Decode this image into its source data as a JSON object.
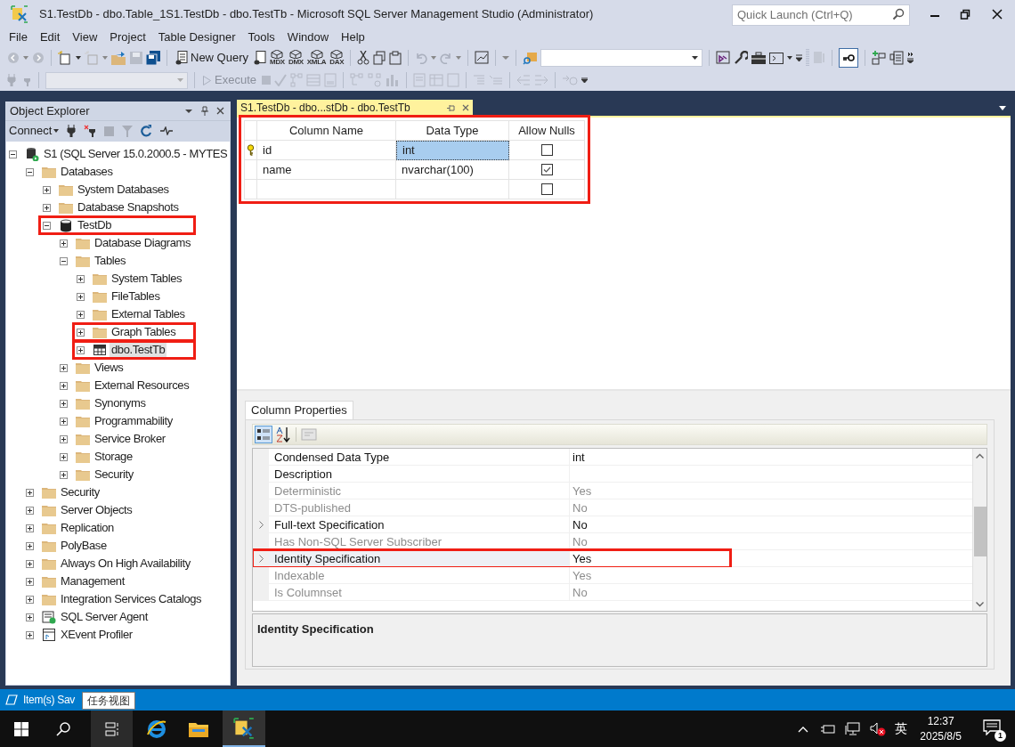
{
  "window": {
    "title": "S1.TestDb - dbo.Table_1S1.TestDb - dbo.TestTb - Microsoft SQL Server Management Studio (Administrator)"
  },
  "quick_launch": {
    "placeholder": "Quick Launch (Ctrl+Q)"
  },
  "menu": [
    "File",
    "Edit",
    "View",
    "Project",
    "Table Designer",
    "Tools",
    "Window",
    "Help"
  ],
  "toolbar": {
    "new_query": "New Query",
    "query_types": [
      "MDX",
      "DMX",
      "XMLA",
      "DAX"
    ],
    "execute": {
      "label": "Execute",
      "disabled": true
    }
  },
  "object_explorer": {
    "title": "Object Explorer",
    "connect": "Connect",
    "tree": [
      {
        "label": "S1 (SQL Server 15.0.2000.5 - MYTES",
        "kind": "server",
        "expanded": true,
        "selected": false,
        "highlighted": false,
        "children": [
          {
            "label": "Databases",
            "kind": "folder",
            "expanded": true,
            "selected": false,
            "highlighted": false,
            "children": [
              {
                "label": "System Databases",
                "kind": "folder",
                "expanded": false,
                "selected": false,
                "highlighted": false
              },
              {
                "label": "Database Snapshots",
                "kind": "folder",
                "expanded": false,
                "selected": false,
                "highlighted": false
              },
              {
                "label": "TestDb",
                "kind": "database",
                "expanded": true,
                "selected": false,
                "highlighted": true,
                "children": [
                  {
                    "label": "Database Diagrams",
                    "kind": "folder",
                    "expanded": false,
                    "selected": false,
                    "highlighted": false
                  },
                  {
                    "label": "Tables",
                    "kind": "folder",
                    "expanded": true,
                    "selected": false,
                    "highlighted": false,
                    "children": [
                      {
                        "label": "System Tables",
                        "kind": "folder",
                        "expanded": false,
                        "selected": false,
                        "highlighted": false
                      },
                      {
                        "label": "FileTables",
                        "kind": "folder",
                        "expanded": false,
                        "selected": false,
                        "highlighted": false
                      },
                      {
                        "label": "External Tables",
                        "kind": "folder",
                        "expanded": false,
                        "selected": false,
                        "highlighted": false
                      },
                      {
                        "label": "Graph Tables",
                        "kind": "folder",
                        "expanded": false,
                        "selected": false,
                        "highlighted": true
                      },
                      {
                        "label": "dbo.TestTb",
                        "kind": "table",
                        "expanded": false,
                        "selected": true,
                        "highlighted": true
                      }
                    ]
                  },
                  {
                    "label": "Views",
                    "kind": "folder",
                    "expanded": false,
                    "selected": false,
                    "highlighted": false
                  },
                  {
                    "label": "External Resources",
                    "kind": "folder",
                    "expanded": false,
                    "selected": false,
                    "highlighted": false
                  },
                  {
                    "label": "Synonyms",
                    "kind": "folder",
                    "expanded": false,
                    "selected": false,
                    "highlighted": false
                  },
                  {
                    "label": "Programmability",
                    "kind": "folder",
                    "expanded": false,
                    "selected": false,
                    "highlighted": false
                  },
                  {
                    "label": "Service Broker",
                    "kind": "folder",
                    "expanded": false,
                    "selected": false,
                    "highlighted": false
                  },
                  {
                    "label": "Storage",
                    "kind": "folder",
                    "expanded": false,
                    "selected": false,
                    "highlighted": false
                  },
                  {
                    "label": "Security",
                    "kind": "folder",
                    "expanded": false,
                    "selected": false,
                    "highlighted": false
                  }
                ]
              }
            ]
          },
          {
            "label": "Security",
            "kind": "folder",
            "expanded": false,
            "selected": false,
            "highlighted": false
          },
          {
            "label": "Server Objects",
            "kind": "folder",
            "expanded": false,
            "selected": false,
            "highlighted": false
          },
          {
            "label": "Replication",
            "kind": "folder",
            "expanded": false,
            "selected": false,
            "highlighted": false
          },
          {
            "label": "PolyBase",
            "kind": "folder",
            "expanded": false,
            "selected": false,
            "highlighted": false
          },
          {
            "label": "Always On High Availability",
            "kind": "folder",
            "expanded": false,
            "selected": false,
            "highlighted": false
          },
          {
            "label": "Management",
            "kind": "folder",
            "expanded": false,
            "selected": false,
            "highlighted": false
          },
          {
            "label": "Integration Services Catalogs",
            "kind": "folder",
            "expanded": false,
            "selected": false,
            "highlighted": false
          },
          {
            "label": "SQL Server Agent",
            "kind": "agent",
            "expanded": false,
            "selected": false,
            "highlighted": false
          },
          {
            "label": "XEvent Profiler",
            "kind": "profiler",
            "expanded": false,
            "selected": false,
            "highlighted": false
          }
        ]
      }
    ]
  },
  "document_tab": {
    "title": "S1.TestDb - dbo...stDb - dbo.TestTb",
    "selected": true
  },
  "designer": {
    "highlighted": true,
    "columns": [
      "Column Name",
      "Data Type",
      "Allow Nulls"
    ],
    "rows": [
      {
        "column_name": "id",
        "data_type": "int",
        "allow_nulls": false,
        "primary_key": true,
        "selected": true
      },
      {
        "column_name": "name",
        "data_type": "nvarchar(100)",
        "allow_nulls": true,
        "primary_key": false,
        "selected": false
      },
      {
        "allow_nulls": false,
        "primary_key": false,
        "selected": false
      }
    ]
  },
  "column_properties": {
    "tab": "Column Properties",
    "rows": [
      {
        "name": "Condensed Data Type",
        "value": "int",
        "disabled": false,
        "expandable": false,
        "selected": false,
        "highlighted": false
      },
      {
        "name": "Description",
        "disabled": false,
        "expandable": false,
        "selected": false,
        "highlighted": false
      },
      {
        "name": "Deterministic",
        "value": "Yes",
        "disabled": true,
        "expandable": false,
        "selected": false,
        "highlighted": false
      },
      {
        "name": "DTS-published",
        "value": "No",
        "disabled": true,
        "expandable": false,
        "selected": false,
        "highlighted": false
      },
      {
        "name": "Full-text Specification",
        "value": "No",
        "disabled": false,
        "expandable": true,
        "selected": false,
        "highlighted": false
      },
      {
        "name": "Has Non-SQL Server Subscriber",
        "value": "No",
        "disabled": true,
        "expandable": false,
        "selected": false,
        "highlighted": false
      },
      {
        "name": "Identity Specification",
        "value": "Yes",
        "disabled": false,
        "expandable": true,
        "selected": true,
        "highlighted": true
      },
      {
        "name": "Indexable",
        "value": "Yes",
        "disabled": true,
        "expandable": false,
        "selected": false,
        "highlighted": false
      },
      {
        "name": "Is Columnset",
        "value": "No",
        "disabled": true,
        "expandable": false,
        "selected": false,
        "highlighted": false
      }
    ],
    "description_title": "Identity Specification"
  },
  "status_bar": {
    "text": "Item(s) Sav"
  },
  "tooltip": {
    "text": "任务视图"
  },
  "taskbar": {
    "ime": "英",
    "time": "12:37",
    "date": "2025/8/5",
    "notification_count": "1"
  }
}
